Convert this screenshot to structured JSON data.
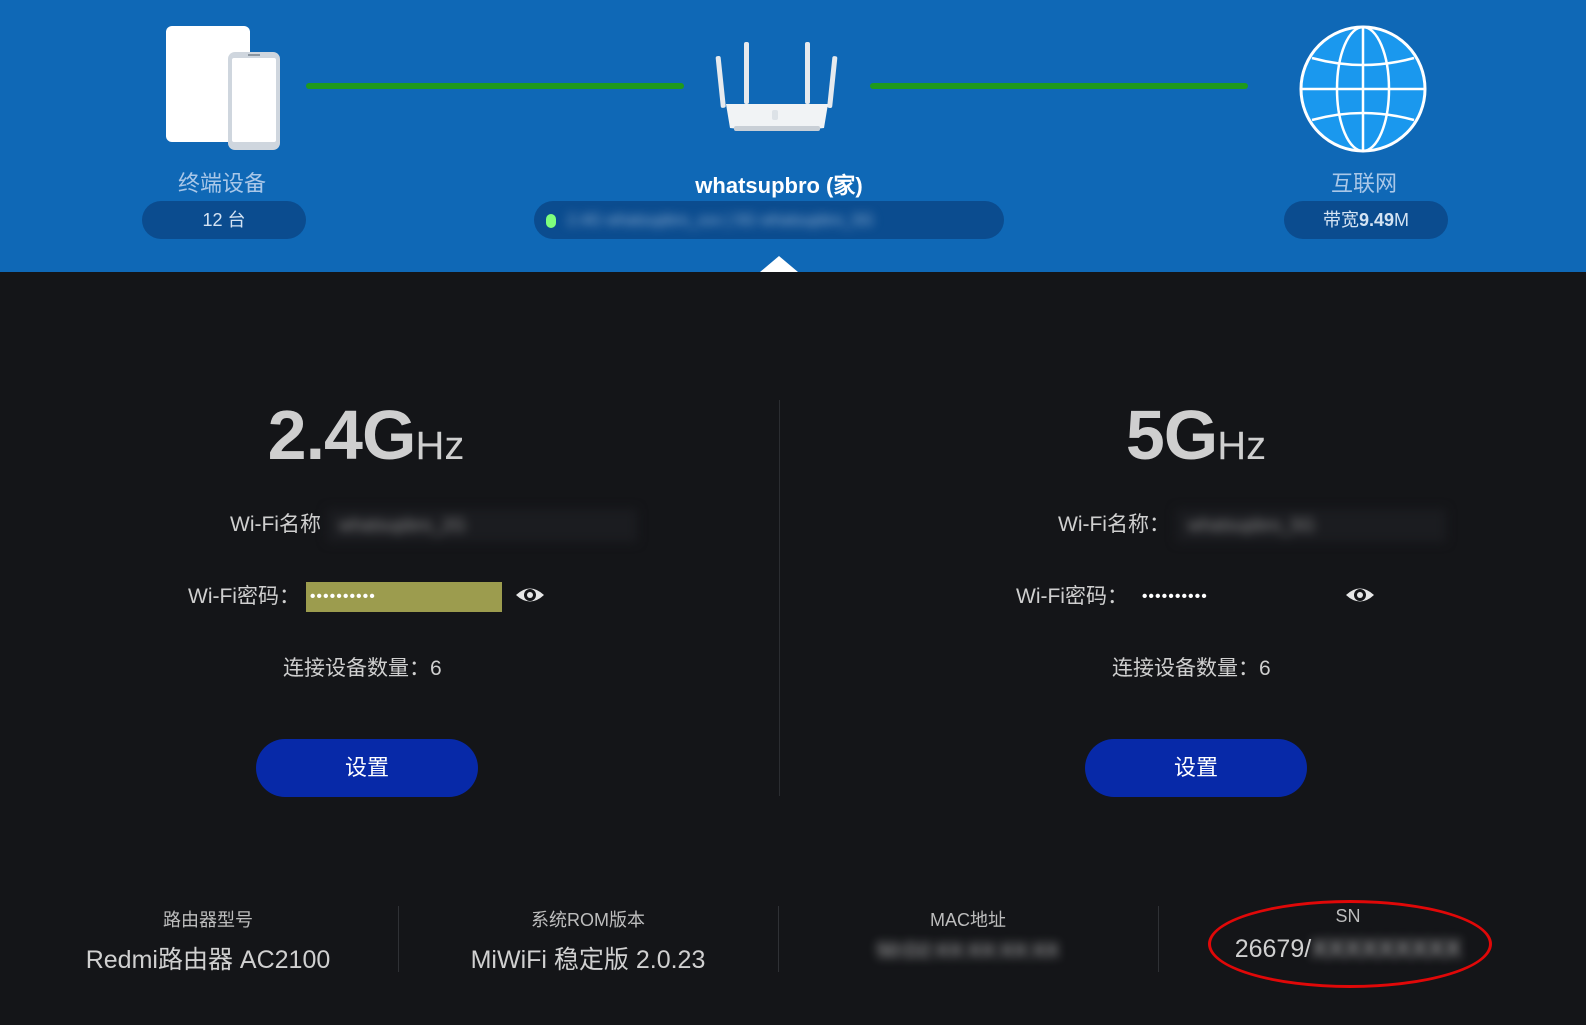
{
  "topology": {
    "devices": {
      "label": "终端设备",
      "count": "12 台"
    },
    "router": {
      "name": "whatsupbro (家)",
      "status_text": "2.4G whatsupbro_xxx | 5G whatsupbro_5G"
    },
    "internet": {
      "label": "互联网",
      "bandwidth_prefix": "带宽",
      "bandwidth_value": "9.49",
      "bandwidth_unit": "M"
    },
    "colors": {
      "banner": "#0f68b6",
      "link_line": "#1f9a1c",
      "status_led": "#7dff7d"
    }
  },
  "bands": {
    "b24": {
      "freq": "2.4G",
      "unit": "Hz",
      "ssid_label": "Wi-Fi名称",
      "ssid_value": "whatsupbro_2G",
      "password_label": "Wi-Fi密码：",
      "password_value": "••••••••••",
      "devices_text": "连接设备数量：6",
      "settings_label": "设置"
    },
    "b5": {
      "freq": "5G",
      "unit": "Hz",
      "ssid_label": "Wi-Fi名称：",
      "ssid_value": "whatsupbro_5G",
      "password_label": "Wi-Fi密码：",
      "password_value": "••••••••••",
      "devices_text": "连接设备数量：6",
      "settings_label": "设置"
    }
  },
  "info": {
    "model": {
      "label": "路由器型号",
      "value": "Redmi路由器 AC2100"
    },
    "rom": {
      "label": "系统ROM版本",
      "value": "MiWiFi 稳定版 2.0.23"
    },
    "mac": {
      "label": "MAC地址",
      "value": "50:D2:XX:XX:XX:XX"
    },
    "sn": {
      "label": "SN",
      "value_visible": "26679/",
      "value_hidden": "XXXXXXXXX"
    }
  },
  "accent": {
    "button": "#0729a8",
    "highlight_circle": "#e00808",
    "password_highlight": "#9c9c4e"
  }
}
